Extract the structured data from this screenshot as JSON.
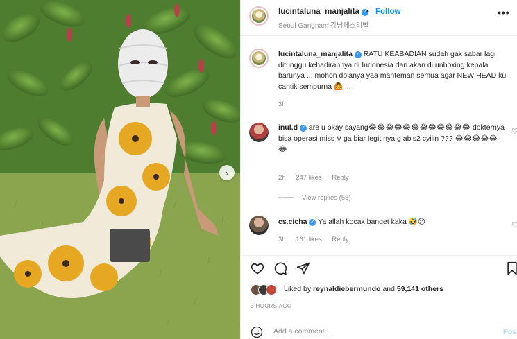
{
  "post": {
    "username": "lucintaluna_manjalita",
    "follow_label": "Follow",
    "location": "Seoul Gangnam 강남페스티벌",
    "separator": "•",
    "more_label": "•••"
  },
  "caption": {
    "username": "lucintaluna_manjalita",
    "text": "RATU KEABADIAN sudah gak sabar lagi ditunggu kehadirannya di Indonesia dan akan di unboxing kepala barunya ... mohon do'anya yaa manteman semua agar NEW HEAD ku cantik sempurna 🙆 ...",
    "time": "3h"
  },
  "comments": [
    {
      "username": "inul.d",
      "text": "are u okay sayang😂😂😂😂😂😂😂😂😂😂😂😂 dokternya bisa operasi miss V ga biar legit nya g abis2 cyiiin ??? 😂😂😂😂😂 😂",
      "time": "2h",
      "likes": "247 likes",
      "reply": "Reply",
      "view_replies": "View replies (53)"
    },
    {
      "username": "cs.cicha",
      "text": "Ya allah kocak banget kaka 🤣😍",
      "time": "3h",
      "likes": "161 likes",
      "reply": "Reply"
    }
  ],
  "likes": {
    "prefix": "Liked by",
    "user": "reynaldiebermundo",
    "and": "and",
    "count": "59,141 others"
  },
  "time_ago": "3 HOURS AGO",
  "comment_input": {
    "placeholder": "Add a comment…",
    "post_label": "Post"
  },
  "colors": {
    "accent": "#0095f6",
    "verified": "#3897f0",
    "muted": "#8e8e8e"
  },
  "icons": {
    "like": "heart-icon",
    "comment": "comment-icon",
    "share": "paper-plane-icon",
    "save": "bookmark-icon",
    "emoji": "smiley-icon",
    "next": "chevron-right-icon"
  }
}
